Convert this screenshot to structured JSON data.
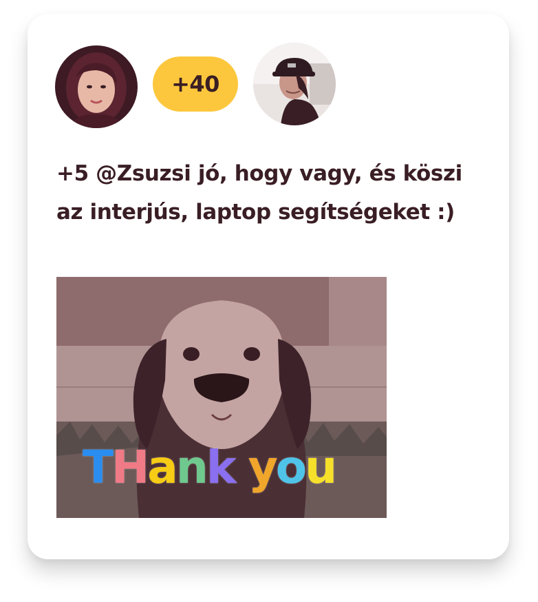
{
  "post": {
    "reaction_count": "+40",
    "message": "+5 @Zsuzsi jó, hogy vagy, és köszi az interjús, laptop segítségeket :)",
    "gif": {
      "caption_letters": [
        "T",
        "H",
        "a",
        "n",
        "k",
        " ",
        "y",
        "o",
        "u"
      ],
      "caption_colors": [
        "#2a8df0",
        "#f07a86",
        "#f6cc14",
        "#6fc98e",
        "#8a6ff0",
        "",
        "#f0a62a",
        "#4fc4e8",
        "#f6e02a"
      ]
    }
  },
  "colors": {
    "badge": "#fcc73c",
    "text": "#3a1e25",
    "card": "#ffffff"
  },
  "icons": {
    "avatar_1": "woman-avatar",
    "avatar_2": "man-with-cap-avatar"
  }
}
